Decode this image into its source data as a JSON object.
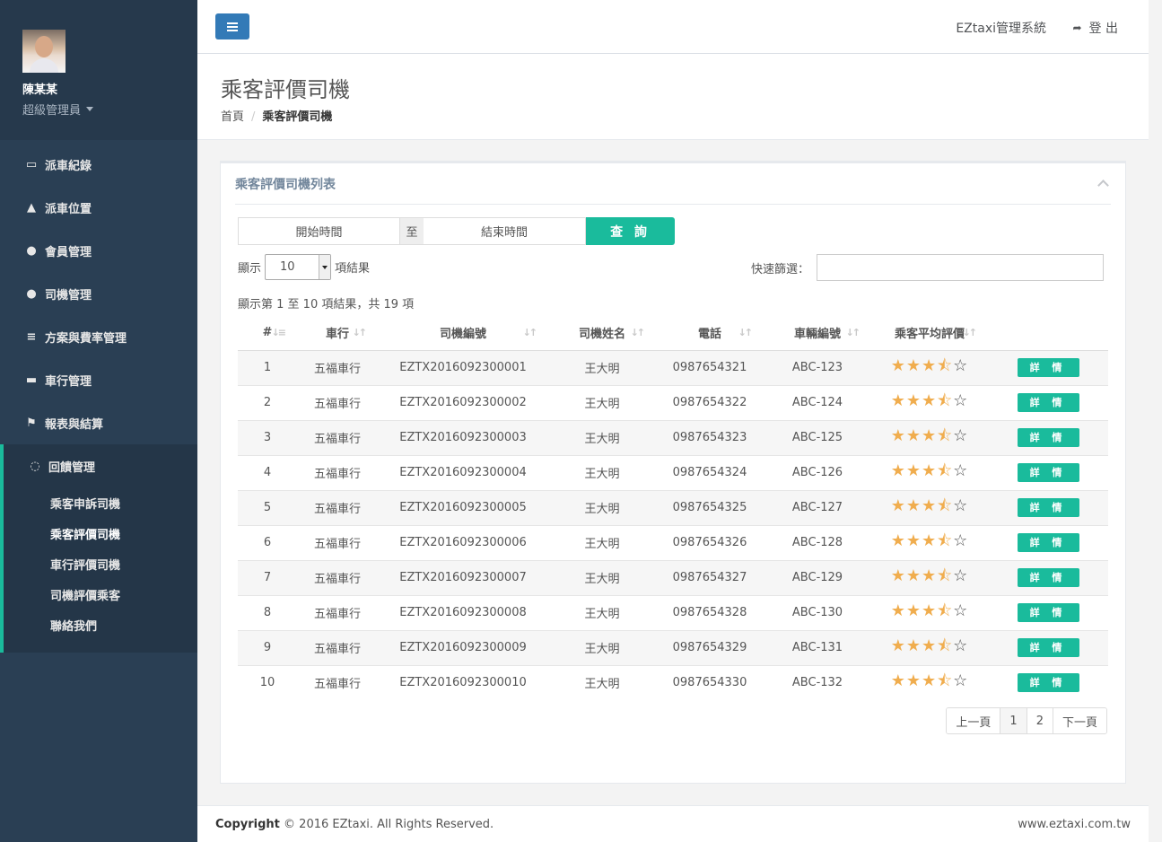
{
  "user": {
    "name": "陳某某",
    "role": "超級管理員"
  },
  "sidebar": {
    "items": [
      {
        "icon": "monitor-icon",
        "glyph": "▭",
        "label": "派車紀錄"
      },
      {
        "icon": "road-icon",
        "glyph": "▲",
        "label": "派車位置"
      },
      {
        "icon": "user-icon",
        "glyph": "●",
        "label": "會員管理"
      },
      {
        "icon": "users-icon",
        "glyph": "●",
        "label": "司機管理"
      },
      {
        "icon": "sliders-icon",
        "glyph": "≡",
        "label": "方案與費率管理"
      },
      {
        "icon": "car-icon",
        "glyph": "▬",
        "label": "車行管理"
      },
      {
        "icon": "flag-icon",
        "glyph": "⚑",
        "label": "報表與結算"
      }
    ],
    "active": {
      "icon": "comment-icon",
      "glyph": "◌",
      "label": "回饋管理"
    },
    "sub_items": [
      "乘客申訴司機",
      "乘客評價司機",
      "車行評價司機",
      "司機評價乘客",
      "聯絡我們"
    ]
  },
  "topbar": {
    "system_name": "EZtaxi管理系統",
    "logout_label": "登 出"
  },
  "page": {
    "title": "乘客評價司機",
    "breadcrumb_home": "首頁",
    "breadcrumb_sep": "/",
    "breadcrumb_current": "乘客評價司機"
  },
  "panel": {
    "title": "乘客評價司機列表"
  },
  "filter": {
    "start_placeholder": "開始時間",
    "to_label": "至",
    "end_placeholder": "結束時間",
    "query_label": "查 詢",
    "show_label": "顯示",
    "page_length": "10",
    "results_label": "項結果",
    "quick_filter_label": "快速篩選：",
    "info": "顯示第 1 至 10 項結果，共 19 項"
  },
  "table": {
    "headers": [
      "#",
      "車行",
      "司機編號",
      "司機姓名",
      "電話",
      "車輛編號",
      "乘客平均評價",
      ""
    ],
    "detail_label": "詳 情",
    "rating": {
      "value": 3.5,
      "max": 5
    },
    "rows": [
      {
        "no": "1",
        "company": "五福車行",
        "driver_id": "EZTX2016092300001",
        "driver_name": "王大明",
        "phone": "0987654321",
        "plate": "ABC-123"
      },
      {
        "no": "2",
        "company": "五福車行",
        "driver_id": "EZTX2016092300002",
        "driver_name": "王大明",
        "phone": "0987654322",
        "plate": "ABC-124"
      },
      {
        "no": "3",
        "company": "五福車行",
        "driver_id": "EZTX2016092300003",
        "driver_name": "王大明",
        "phone": "0987654323",
        "plate": "ABC-125"
      },
      {
        "no": "4",
        "company": "五福車行",
        "driver_id": "EZTX2016092300004",
        "driver_name": "王大明",
        "phone": "0987654324",
        "plate": "ABC-126"
      },
      {
        "no": "5",
        "company": "五福車行",
        "driver_id": "EZTX2016092300005",
        "driver_name": "王大明",
        "phone": "0987654325",
        "plate": "ABC-127"
      },
      {
        "no": "6",
        "company": "五福車行",
        "driver_id": "EZTX2016092300006",
        "driver_name": "王大明",
        "phone": "0987654326",
        "plate": "ABC-128"
      },
      {
        "no": "7",
        "company": "五福車行",
        "driver_id": "EZTX2016092300007",
        "driver_name": "王大明",
        "phone": "0987654327",
        "plate": "ABC-129"
      },
      {
        "no": "8",
        "company": "五福車行",
        "driver_id": "EZTX2016092300008",
        "driver_name": "王大明",
        "phone": "0987654328",
        "plate": "ABC-130"
      },
      {
        "no": "9",
        "company": "五福車行",
        "driver_id": "EZTX2016092300009",
        "driver_name": "王大明",
        "phone": "0987654329",
        "plate": "ABC-131"
      },
      {
        "no": "10",
        "company": "五福車行",
        "driver_id": "EZTX2016092300010",
        "driver_name": "王大明",
        "phone": "0987654330",
        "plate": "ABC-132"
      }
    ]
  },
  "pagination": {
    "prev": "上一頁",
    "pages": [
      "1",
      "2"
    ],
    "current": "1",
    "next": "下一頁"
  },
  "footer": {
    "copyright_bold": "Copyright",
    "copyright_rest": " © 2016 EZtaxi. All Rights Reserved.",
    "site": "www.eztaxi.com.tw"
  },
  "colors": {
    "sidebar": "#2a3f54",
    "accent": "#1abb9c",
    "primary": "#337ab7",
    "star": "#f0ad4e"
  }
}
